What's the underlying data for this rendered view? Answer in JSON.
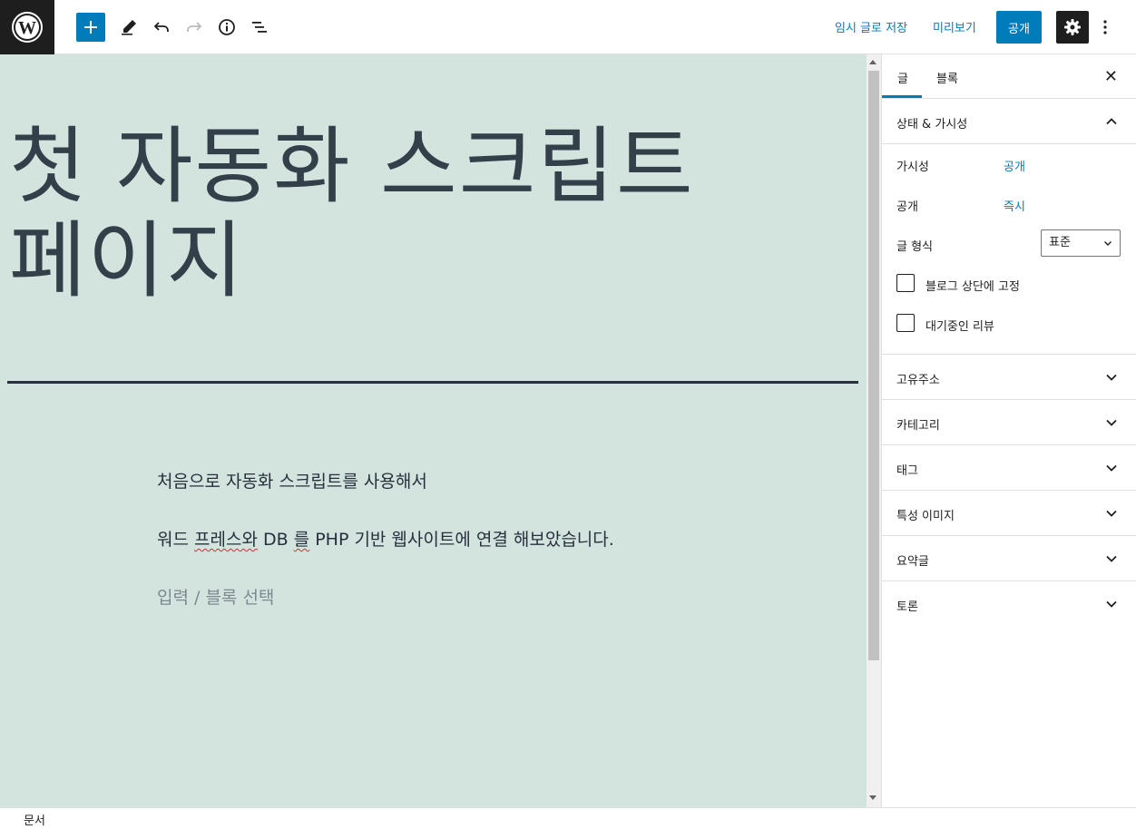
{
  "toolbar": {
    "logo_icon": "wordpress-logo-icon",
    "add_block_icon": "plus-icon",
    "tools_icon": "pencil-icon",
    "undo_icon": "undo-icon",
    "redo_icon": "redo-icon",
    "details_icon": "info-icon",
    "outline_icon": "list-view-icon",
    "save_draft": "임시 글로 저장",
    "preview": "미리보기",
    "publish": "공개",
    "settings_icon": "gear-icon",
    "more_icon": "more-vertical-icon",
    "accent_color": "#007cba"
  },
  "editor": {
    "background": "#d3e4de",
    "title_line1": "첫 자동화 스크립트",
    "title_line2": "페이지",
    "paragraph1": "처음으로  자동화 스크립트를 사용해서",
    "paragraph2_a": "워드 ",
    "paragraph2_b": "프레스와",
    "paragraph2_c": " DB ",
    "paragraph2_d": "를",
    "paragraph2_e": " PHP 기반 웹사이트에 연결 해보았습니다.",
    "placeholder": "입력 / 블록 선택"
  },
  "sidebar": {
    "tab_post": "글",
    "tab_block": "블록",
    "close_icon": "close-icon",
    "status_panel": {
      "title": "상태 & 가시성",
      "visibility_label": "가시성",
      "visibility_value": "공개",
      "publish_label": "공개",
      "publish_value": "즉시",
      "format_label": "글 형식",
      "format_value": "표준",
      "sticky_label": "블로그 상단에 고정",
      "pending_label": "대기중인 리뷰"
    },
    "panels": [
      "고유주소",
      "카테고리",
      "태그",
      "특성 이미지",
      "요약글",
      "토론"
    ]
  },
  "footer": {
    "breadcrumb": "문서"
  }
}
